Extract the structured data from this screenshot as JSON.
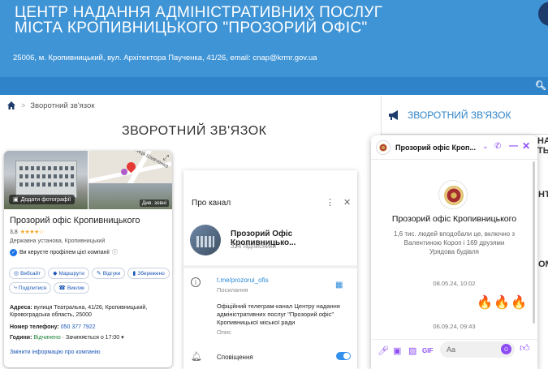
{
  "site": {
    "title_line1": "ЦЕНТР НАДАННЯ АДМІНІСТРАТИВНИХ ПОСЛУГ",
    "title_line2": "МІСТА КРОПИВНИЦЬКОГО \"ПРОЗОРИЙ ОФІС\"",
    "address": "25006, м. Кропивницький, вул. Архітектора Паученка, 41/26, email: cnap@krmr.gov.ua",
    "accent": "#3f94d6",
    "nav_color": "#2f84c9"
  },
  "breadcrumb": {
    "home_icon": "home-icon",
    "current": "Зворотний зв'язок"
  },
  "page_title": "ЗВОРОТНИЙ ЗВ'ЯЗОК",
  "sidebar": {
    "feedback_label": "ЗВОРОТНИЙ ЗВ'ЯЗОК",
    "peek1": "НА",
    "peek2": "ТЬ",
    "peek3": "НТ",
    "peek4": "ОМ"
  },
  "google_card": {
    "add_photo_label": "Додати фотографії",
    "street_label": "вулиця Шевченка",
    "street_view_label": "Див. зовні",
    "name": "Прозорий офіс Кропивницького",
    "rating": "3,8",
    "stars": "★★★★☆",
    "category": "Державна установа, Кропивницький",
    "verify_text": "Ви керуєте профілем цієї компанії",
    "actions": [
      {
        "label": "Вебсайт",
        "icon": "◎"
      },
      {
        "label": "Маршрути",
        "icon": "◆"
      },
      {
        "label": "Відгуки",
        "icon": "✎"
      },
      {
        "label": "Збережено",
        "icon": "▮"
      },
      {
        "label": "Поділитися",
        "icon": "⤷"
      },
      {
        "label": "Виклик",
        "icon": "☎"
      }
    ],
    "address_label": "Адреса:",
    "address_value": "вулиця Театральна, 41/26, Кропивницький, Кіровоградська область, 25000",
    "phone_label": "Номер телефону:",
    "phone_value": "050 377 7922",
    "hours_label": "Години:",
    "hours_open": "Відчинено",
    "hours_close": "· Зачиняється о 17:00 ▾",
    "edit_link": "Змінити інформацію про компанію"
  },
  "telegram": {
    "header": "Про канал",
    "channel_name": "Прозорий Офіс Кропивницько...",
    "subscribers": "324 підписники",
    "link": "t.me/prozorui_ofis",
    "link_label": "Посилання",
    "description": "Офіційний телеграм-канал Центру надання адміністративних послуг \"Прозорий офіс\" Кропивницької міської ради",
    "description_label": "Опис",
    "notifications": "Сповіщення",
    "notifications_on": true
  },
  "messenger": {
    "title": "Прозорий офіс Кроп...",
    "page_name": "Прозорий офіс Кропивницького",
    "likes": "1,6 тис. людей вподобали це, включно з Валентиною Короп і 169 друзями",
    "category": "Урядова будівля",
    "date1": "08.05.24, 10:02",
    "message": "🔥🔥🔥",
    "date2": "06.09.24, 09:43",
    "input_placeholder": "Aa",
    "brand": "#8e4cf6"
  }
}
